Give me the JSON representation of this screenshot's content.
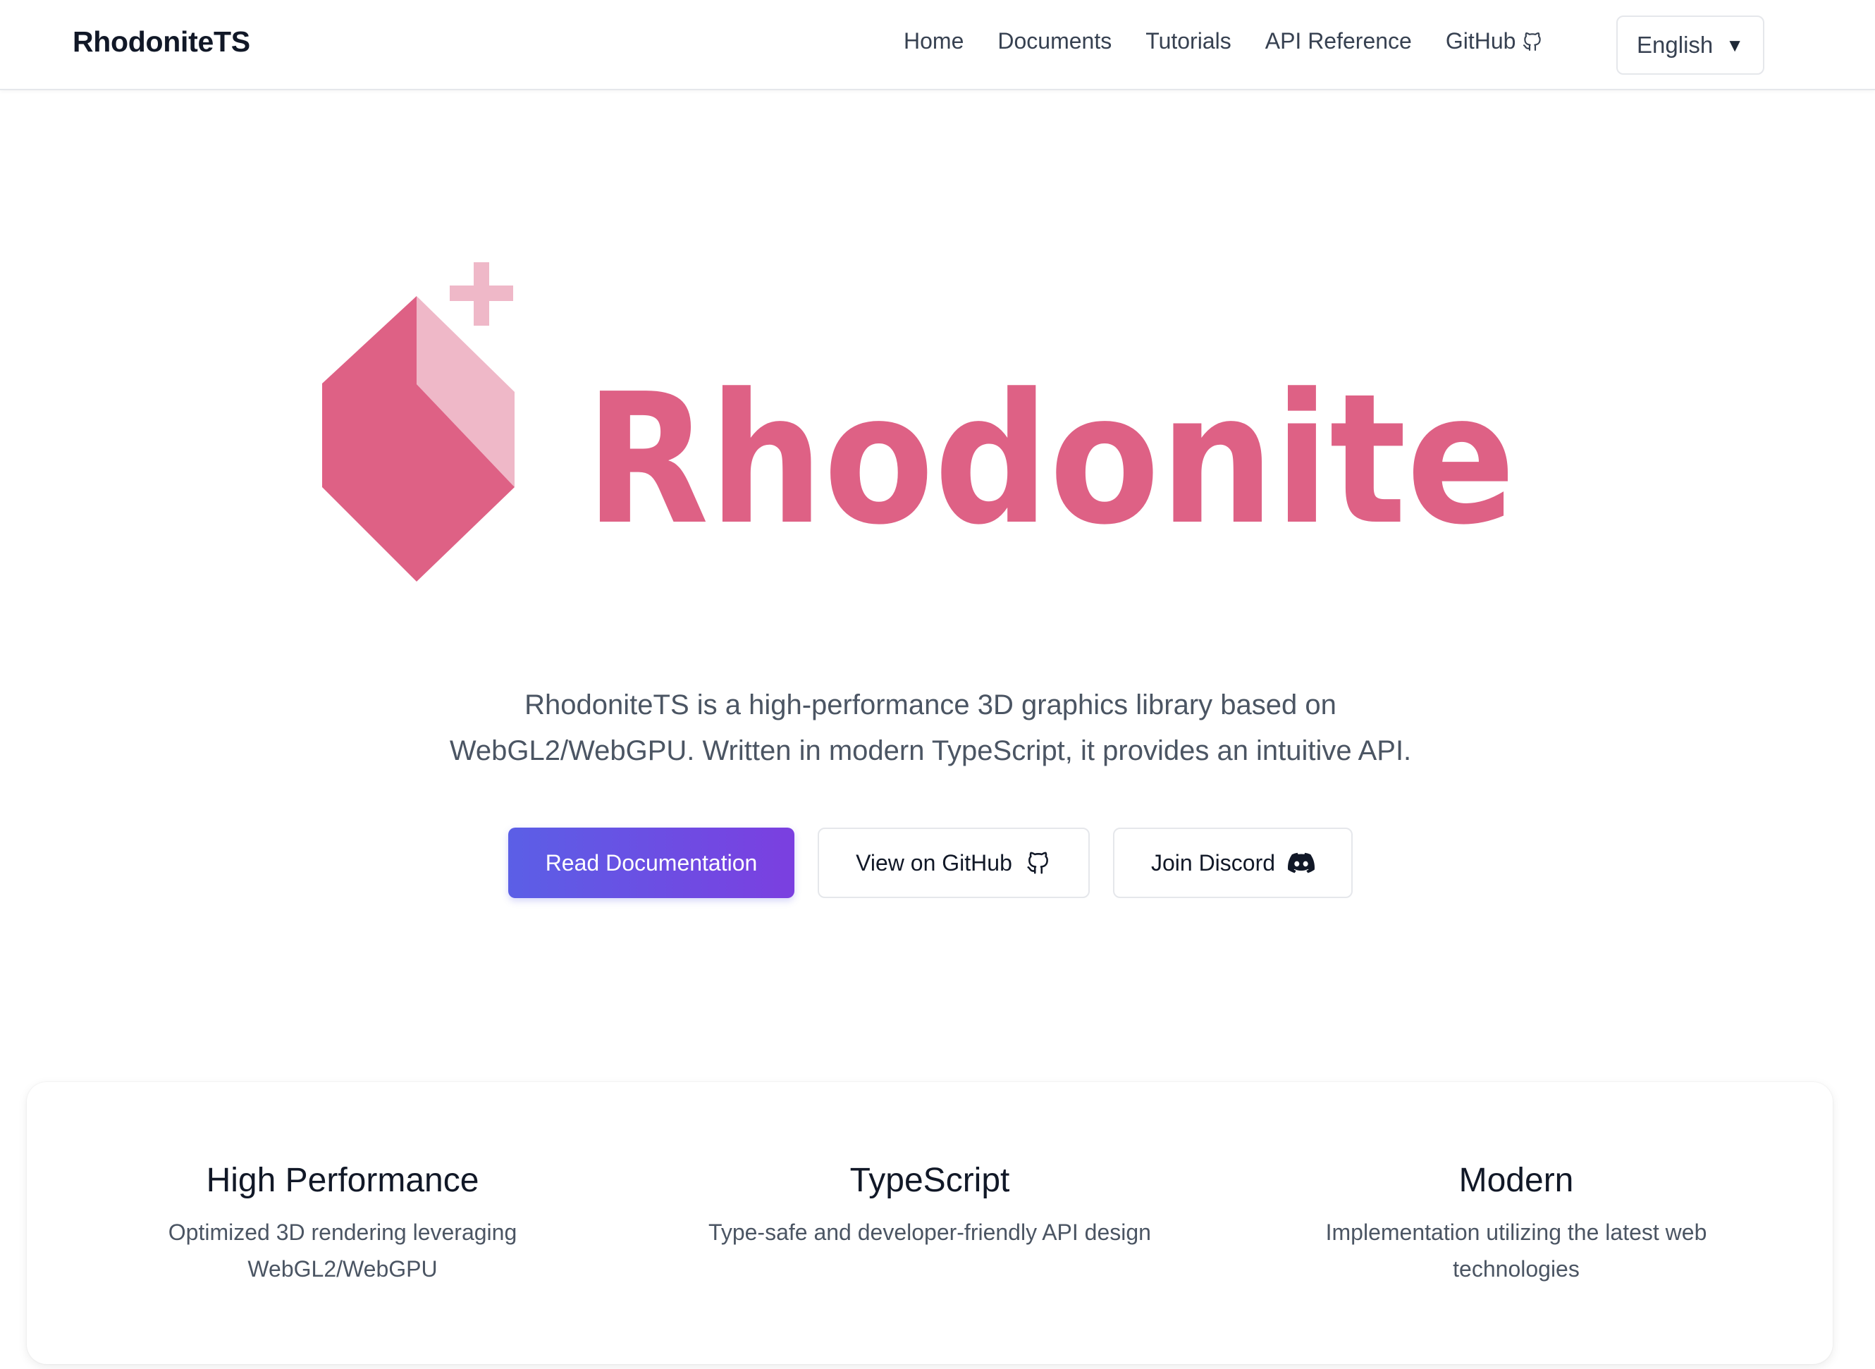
{
  "navbar": {
    "brand": "RhodoniteTS",
    "links": [
      {
        "label": "Home"
      },
      {
        "label": "Documents"
      },
      {
        "label": "Tutorials"
      },
      {
        "label": "API Reference"
      },
      {
        "label": "GitHub",
        "icon": "github-icon"
      }
    ],
    "language": {
      "selected": "English",
      "icon": "caret-down-icon"
    }
  },
  "hero": {
    "logo_text": "Rhodonite",
    "logo_colors": {
      "primary": "#de6185",
      "light": "#efb8c8"
    },
    "description_line1": "RhodoniteTS is a high-performance 3D graphics library based on",
    "description_line2": "WebGL2/WebGPU. Written in modern TypeScript, it provides an intuitive API.",
    "buttons": {
      "primary": {
        "label": "Read Documentation",
        "gradient": [
          "#5b5fe6",
          "#7b3fe0"
        ]
      },
      "github": {
        "label": "View on GitHub",
        "icon": "github-icon"
      },
      "discord": {
        "label": "Join Discord",
        "icon": "discord-icon"
      }
    }
  },
  "features": [
    {
      "title": "High Performance",
      "desc_line1": "Optimized 3D rendering leveraging",
      "desc_line2": "WebGL2/WebGPU"
    },
    {
      "title": "TypeScript",
      "desc_line1": "Type-safe and developer-friendly API design",
      "desc_line2": ""
    },
    {
      "title": "Modern",
      "desc_line1": "Implementation utilizing the latest web",
      "desc_line2": "technologies"
    }
  ]
}
